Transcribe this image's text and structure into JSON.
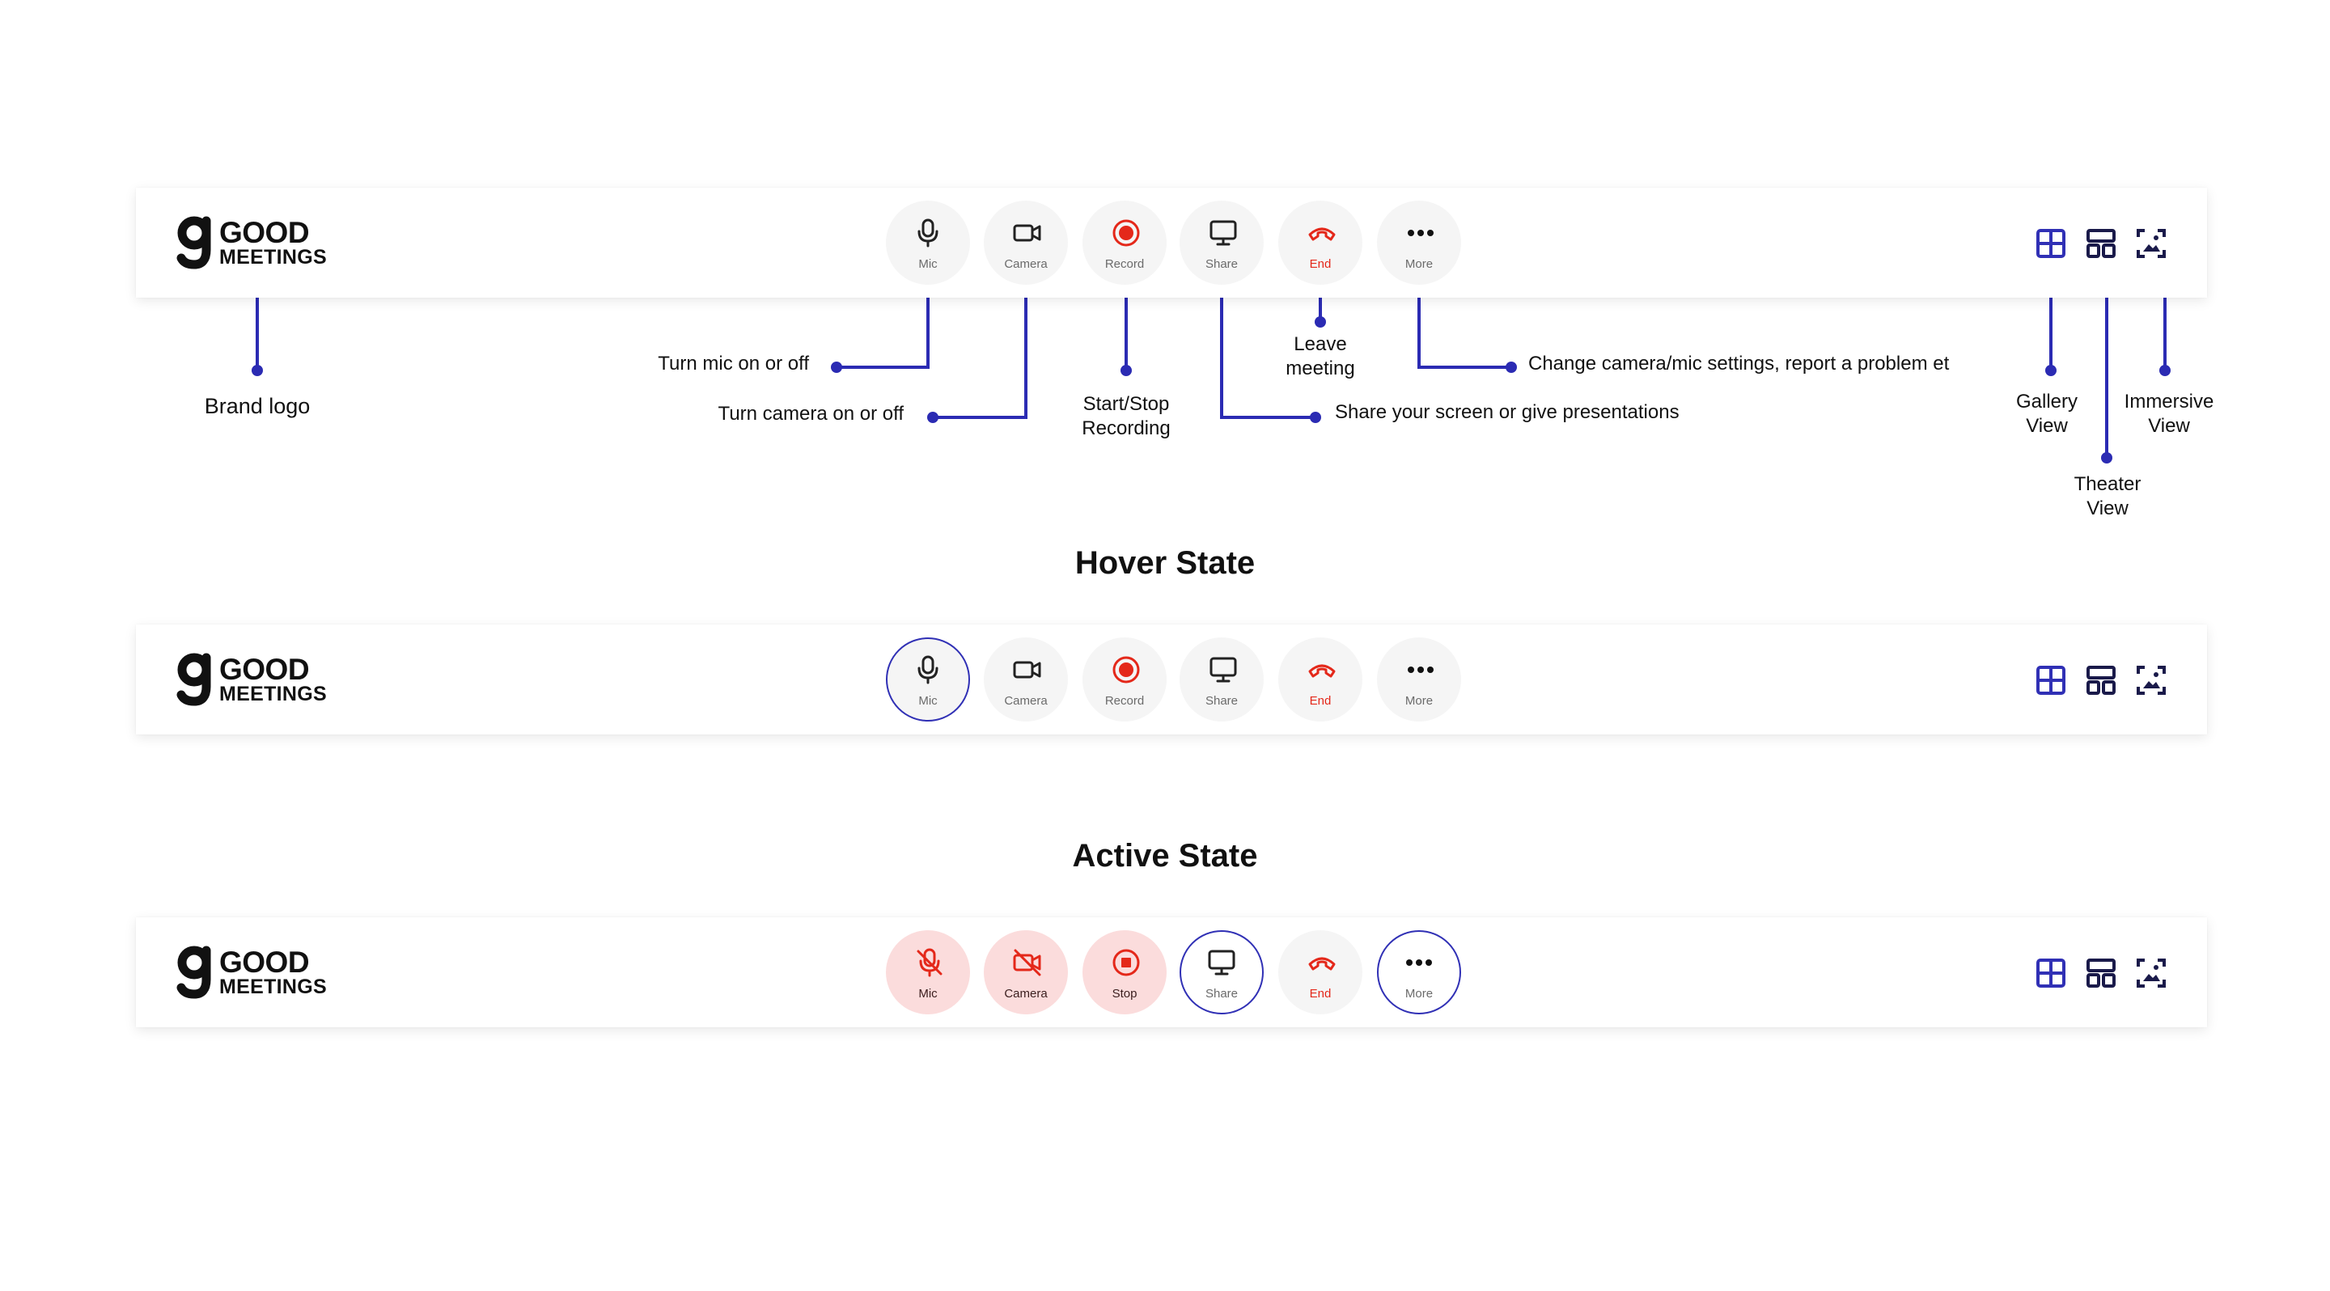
{
  "brand": {
    "line1": "GOOD",
    "line2": "MEETINGS"
  },
  "colors": {
    "accent": "#3030b5",
    "end_red": "#e4281a",
    "active_bg": "#fbdcdc",
    "button_bg": "#f5f5f5"
  },
  "toolbar_buttons": {
    "mic": "Mic",
    "camera": "Camera",
    "record": "Record",
    "share": "Share",
    "end": "End",
    "more": "More",
    "stop": "Stop"
  },
  "view_icons": [
    "grid-icon",
    "theater-layout-icon",
    "immersive-icon"
  ],
  "annotations": {
    "brand_logo": "Brand logo",
    "mic": "Turn mic on or off",
    "camera": "Turn camera on or off",
    "record_l1": "Start/Stop",
    "record_l2": "Recording",
    "end_l1": "Leave",
    "end_l2": "meeting",
    "share": "Share your screen or give presentations",
    "more": "Change camera/mic settings, report a problem et",
    "gallery_l1": "Gallery",
    "gallery_l2": "View",
    "theater_l1": "Theater",
    "theater_l2": "View",
    "immersive_l1": "Immersive",
    "immersive_l2": "View"
  },
  "sections": {
    "hover": "Hover State",
    "active": "Active State"
  }
}
